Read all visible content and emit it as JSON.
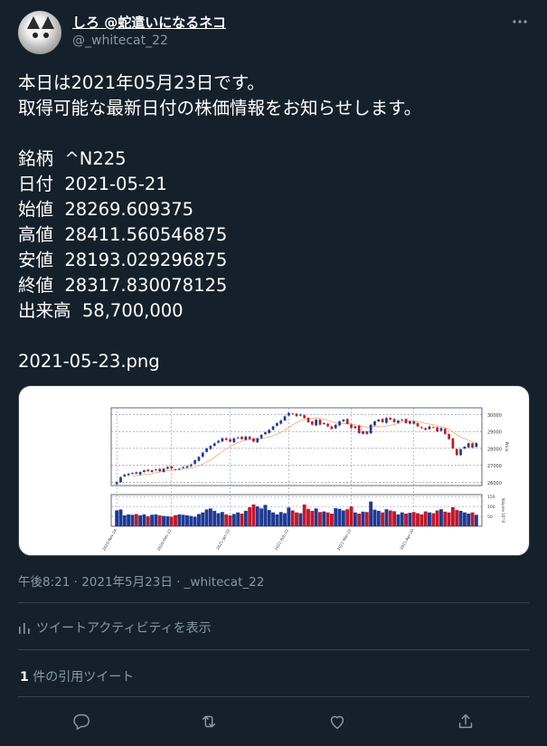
{
  "user": {
    "display_name": "しろ @蛇遣いになるネコ",
    "handle": "@_whitecat_22"
  },
  "tweet": {
    "text": "本日は2021年05月23日です。\n取得可能な最新日付の株価情報をお知らせします。\n\n銘柄  ^N225\n日付  2021-05-21\n始値  28269.609375\n高値  28411.560546875\n安値  28193.029296875\n終値  28317.830078125\n出来高  58,700,000\n\n2021-05-23.png"
  },
  "meta": {
    "timestamp": "午後8:21 · 2021年5月23日 · _whitecat_22",
    "activity_label": "ツイートアクティビティを表示",
    "quote_count": "1",
    "quote_label": "件の引用ツイート"
  },
  "icons": [
    "more-icon",
    "stats-icon",
    "reply-icon",
    "retweet-icon",
    "like-icon",
    "share-icon"
  ],
  "colors": {
    "background": "#15202b",
    "muted": "#8899a6",
    "border": "#38444d",
    "up_candle": "#1f3a93",
    "down_candle": "#c0182c"
  },
  "chart_data": {
    "type": "candlestick",
    "x_tick_labels": [
      "2020-Nov-24",
      "2020-Dec-22",
      "2021-Jan-22",
      "2021-Feb-22",
      "2021-Mar-22",
      "2021-Apr-20"
    ],
    "price_ticks": [
      26000,
      27000,
      28000,
      29000,
      30000
    ],
    "price_label": "Price",
    "price_ylim": [
      25800,
      30400
    ],
    "volume_ticks": [
      50,
      100,
      150
    ],
    "volume_label": "Volume 10^6",
    "volume_ylim": [
      0,
      160
    ],
    "close": [
      26000,
      26300,
      26450,
      26500,
      26550,
      26500,
      26600,
      26700,
      26650,
      26700,
      26750,
      26650,
      26800,
      26900,
      26800,
      26750,
      26800,
      26900,
      26950,
      27050,
      27300,
      27500,
      27750,
      28000,
      28150,
      28300,
      28450,
      28600,
      28500,
      28400,
      28600,
      28650,
      28550,
      28700,
      28550,
      28400,
      28600,
      28800,
      28950,
      29100,
      29300,
      29500,
      29650,
      29900,
      30100,
      30050,
      29900,
      30000,
      29800,
      29550,
      29400,
      29700,
      29400,
      29500,
      29300,
      29150,
      29400,
      29600,
      29700,
      29450,
      29200,
      29300,
      28900,
      29000,
      28850,
      29400,
      29600,
      29700,
      29550,
      29800,
      29700,
      29550,
      29650,
      29700,
      29500,
      29600,
      29450,
      29300,
      29200,
      29100,
      29300,
      29250,
      29000,
      29200,
      28850,
      28550,
      28000,
      27600,
      27950,
      28100,
      28300,
      28050,
      28318
    ],
    "volume": [
      80,
      85,
      55,
      60,
      58,
      62,
      55,
      60,
      50,
      58,
      60,
      55,
      52,
      50,
      48,
      56,
      60,
      58,
      55,
      52,
      48,
      62,
      70,
      85,
      90,
      78,
      66,
      72,
      60,
      55,
      62,
      70,
      64,
      78,
      96,
      110,
      100,
      90,
      108,
      82,
      70,
      60,
      72,
      66,
      95,
      80,
      70,
      66,
      110,
      88,
      78,
      90,
      72,
      75,
      70,
      64,
      92,
      88,
      80,
      86,
      100,
      70,
      64,
      74,
      72,
      125,
      84,
      78,
      70,
      86,
      80,
      76,
      60,
      70,
      64,
      68,
      72,
      66,
      60,
      75,
      70,
      66,
      80,
      86,
      74,
      70,
      96,
      82,
      78,
      70,
      64,
      70,
      58
    ]
  }
}
